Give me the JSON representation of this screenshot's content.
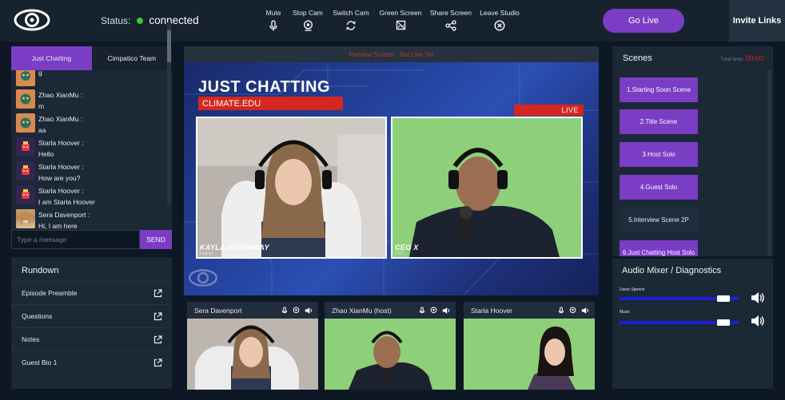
{
  "header": {
    "status_label": "Status:",
    "status_value": "connected",
    "status_color": "#3ec43a",
    "tools": [
      {
        "label": "Mute",
        "icon": "mic-icon"
      },
      {
        "label": "Stop Cam",
        "icon": "webcam-icon"
      },
      {
        "label": "Switch Cam",
        "icon": "refresh-icon"
      },
      {
        "label": "Green Screen",
        "icon": "green-screen-icon"
      },
      {
        "label": "Share Screen",
        "icon": "share-icon"
      },
      {
        "label": "Leave Studio",
        "icon": "close-circle-icon"
      }
    ],
    "go_live_label": "Go Live",
    "invite_label": "Invite Links",
    "accent_color": "#7a3dc4"
  },
  "chat": {
    "tabs": [
      "Just Chatting",
      "Cimpatico Team"
    ],
    "messages": [
      {
        "author": "",
        "text": "g",
        "avatar": "orange"
      },
      {
        "author": "Zhao XianMu :",
        "text": "m",
        "avatar": "orange"
      },
      {
        "author": "Zhao XianMu :",
        "text": "aa",
        "avatar": "orange"
      },
      {
        "author": "Starla Hoover :",
        "text": "Hello",
        "avatar": "purple"
      },
      {
        "author": "Starla Hoover :",
        "text": "How are you?",
        "avatar": "purple"
      },
      {
        "author": "Starla Hoover :",
        "text": "I am Starla Hoover",
        "avatar": "purple"
      },
      {
        "author": "Sera Davenport :",
        "text": "Hi, I am here",
        "avatar": "photo"
      }
    ],
    "input_placeholder": "Type a message",
    "send_label": "SEND"
  },
  "rundown": {
    "title": "Rundown",
    "items": [
      "Episode Preamble",
      "Questions",
      "Notes",
      "Guest Bio 1"
    ]
  },
  "preview": {
    "bar_text": "Preview Screen - Not Live Yet",
    "stage_title": "JUST CHATTING",
    "stage_subtitle": "CLIMATE.EDU",
    "live_label": "LIVE",
    "tiles": [
      {
        "name": "KAYLA HATHAWAY",
        "role": "Partner"
      },
      {
        "name": "CEO X",
        "role": "CEO"
      }
    ]
  },
  "cameras": [
    {
      "name": "Sera Davenport"
    },
    {
      "name": "Zhao XianMu (host)"
    },
    {
      "name": "Starla Hoover"
    }
  ],
  "scenes": {
    "title": "Scenes",
    "total_time_label": "Total time:",
    "total_time_value": "00:00",
    "items": [
      {
        "label": "1.Starting Soon Scene",
        "active": true
      },
      {
        "label": "2.Title Scene",
        "active": true
      },
      {
        "label": "3.Host Solo",
        "active": true
      },
      {
        "label": "4.Guest Solo",
        "active": true
      },
      {
        "label": "5.Interview Scene 2P",
        "active": false
      },
      {
        "label": "6.Just Chatting Host Solo",
        "active": true
      }
    ]
  },
  "mixer": {
    "title": "Audio Mixer / Diagnostics",
    "channels": [
      {
        "label": "Users Speech",
        "level": 0.87
      },
      {
        "label": "Music",
        "level": 0.87
      }
    ]
  }
}
